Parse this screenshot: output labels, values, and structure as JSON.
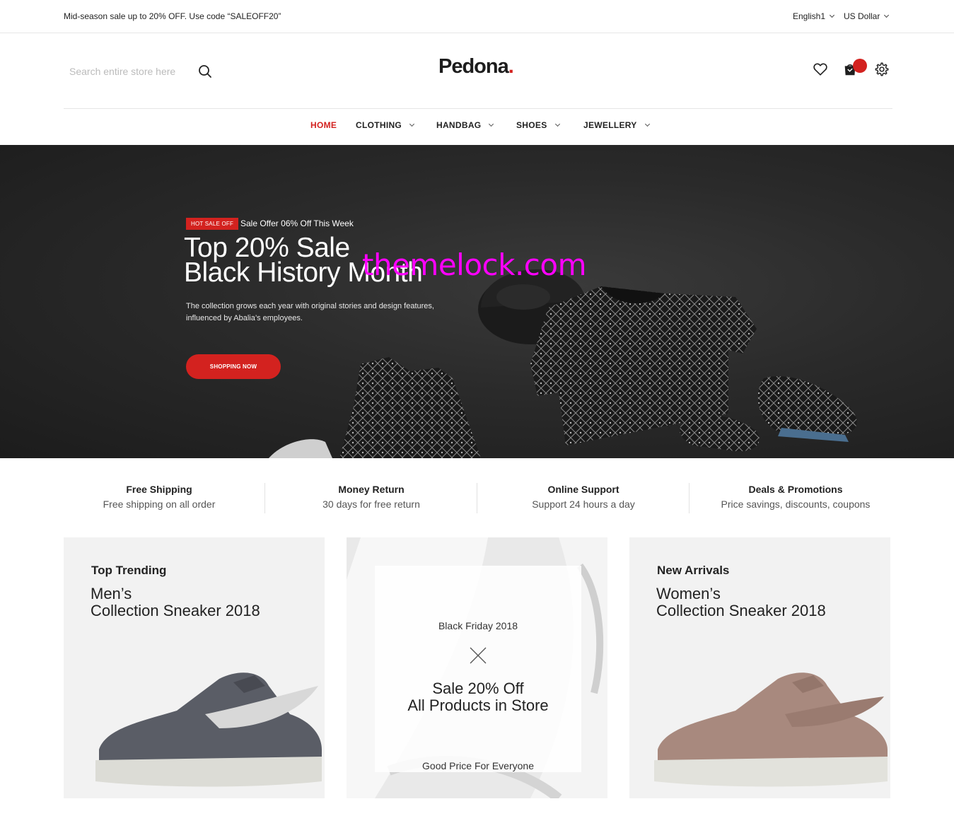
{
  "topbar": {
    "promo": "Mid-season sale up to 20% OFF. Use code “SALEOFF20”",
    "language": "English1",
    "currency": "US Dollar"
  },
  "header": {
    "search_placeholder": "Search entire store here",
    "logo_text": "Pedona",
    "logo_dot": ".",
    "brand_color": "#d3221f",
    "icons": [
      "heart-icon",
      "cart-icon",
      "settings-icon"
    ]
  },
  "nav": {
    "items": [
      {
        "label": "HOME",
        "active": true
      },
      {
        "label": "CLOTHING",
        "dropdown": true
      },
      {
        "label": "HANDBAG",
        "dropdown": true
      },
      {
        "label": "SHOES",
        "dropdown": true
      },
      {
        "label": "JEWELLERY",
        "dropdown": true
      }
    ]
  },
  "hero": {
    "tag": "HOT SALE OFF",
    "offer": "Sale Offer 06% Off This Week",
    "title_line1": "Top 20% Sale",
    "title_line2": "Black History Month",
    "description": "The collection grows each year with original stories and design features, influenced by Abalia’s employees.",
    "button": "SHOPPING NOW",
    "watermark": "themelock.com"
  },
  "features": [
    {
      "title": "Free Shipping",
      "subtitle": "Free shipping on all order"
    },
    {
      "title": "Money Return",
      "subtitle": "30 days for free return"
    },
    {
      "title": "Online Support",
      "subtitle": "Support 24 hours a day"
    },
    {
      "title": "Deals & Promotions",
      "subtitle": "Price savings, discounts, coupons"
    }
  ],
  "banners": {
    "left": {
      "kicker": "Top Trending",
      "title_line1": "Men’s",
      "title_line2": "Collection Sneaker 2018",
      "shoe_color": "#5a5d66"
    },
    "center": {
      "line1": "Black Friday 2018",
      "line2a": "Sale 20% Off",
      "line2b": "All Products in Store",
      "line3": "Good Price For Everyone"
    },
    "right": {
      "kicker": "New Arrivals",
      "title_line1": "Women’s",
      "title_line2": "Collection Sneaker 2018",
      "shoe_color": "#a8897e"
    }
  }
}
